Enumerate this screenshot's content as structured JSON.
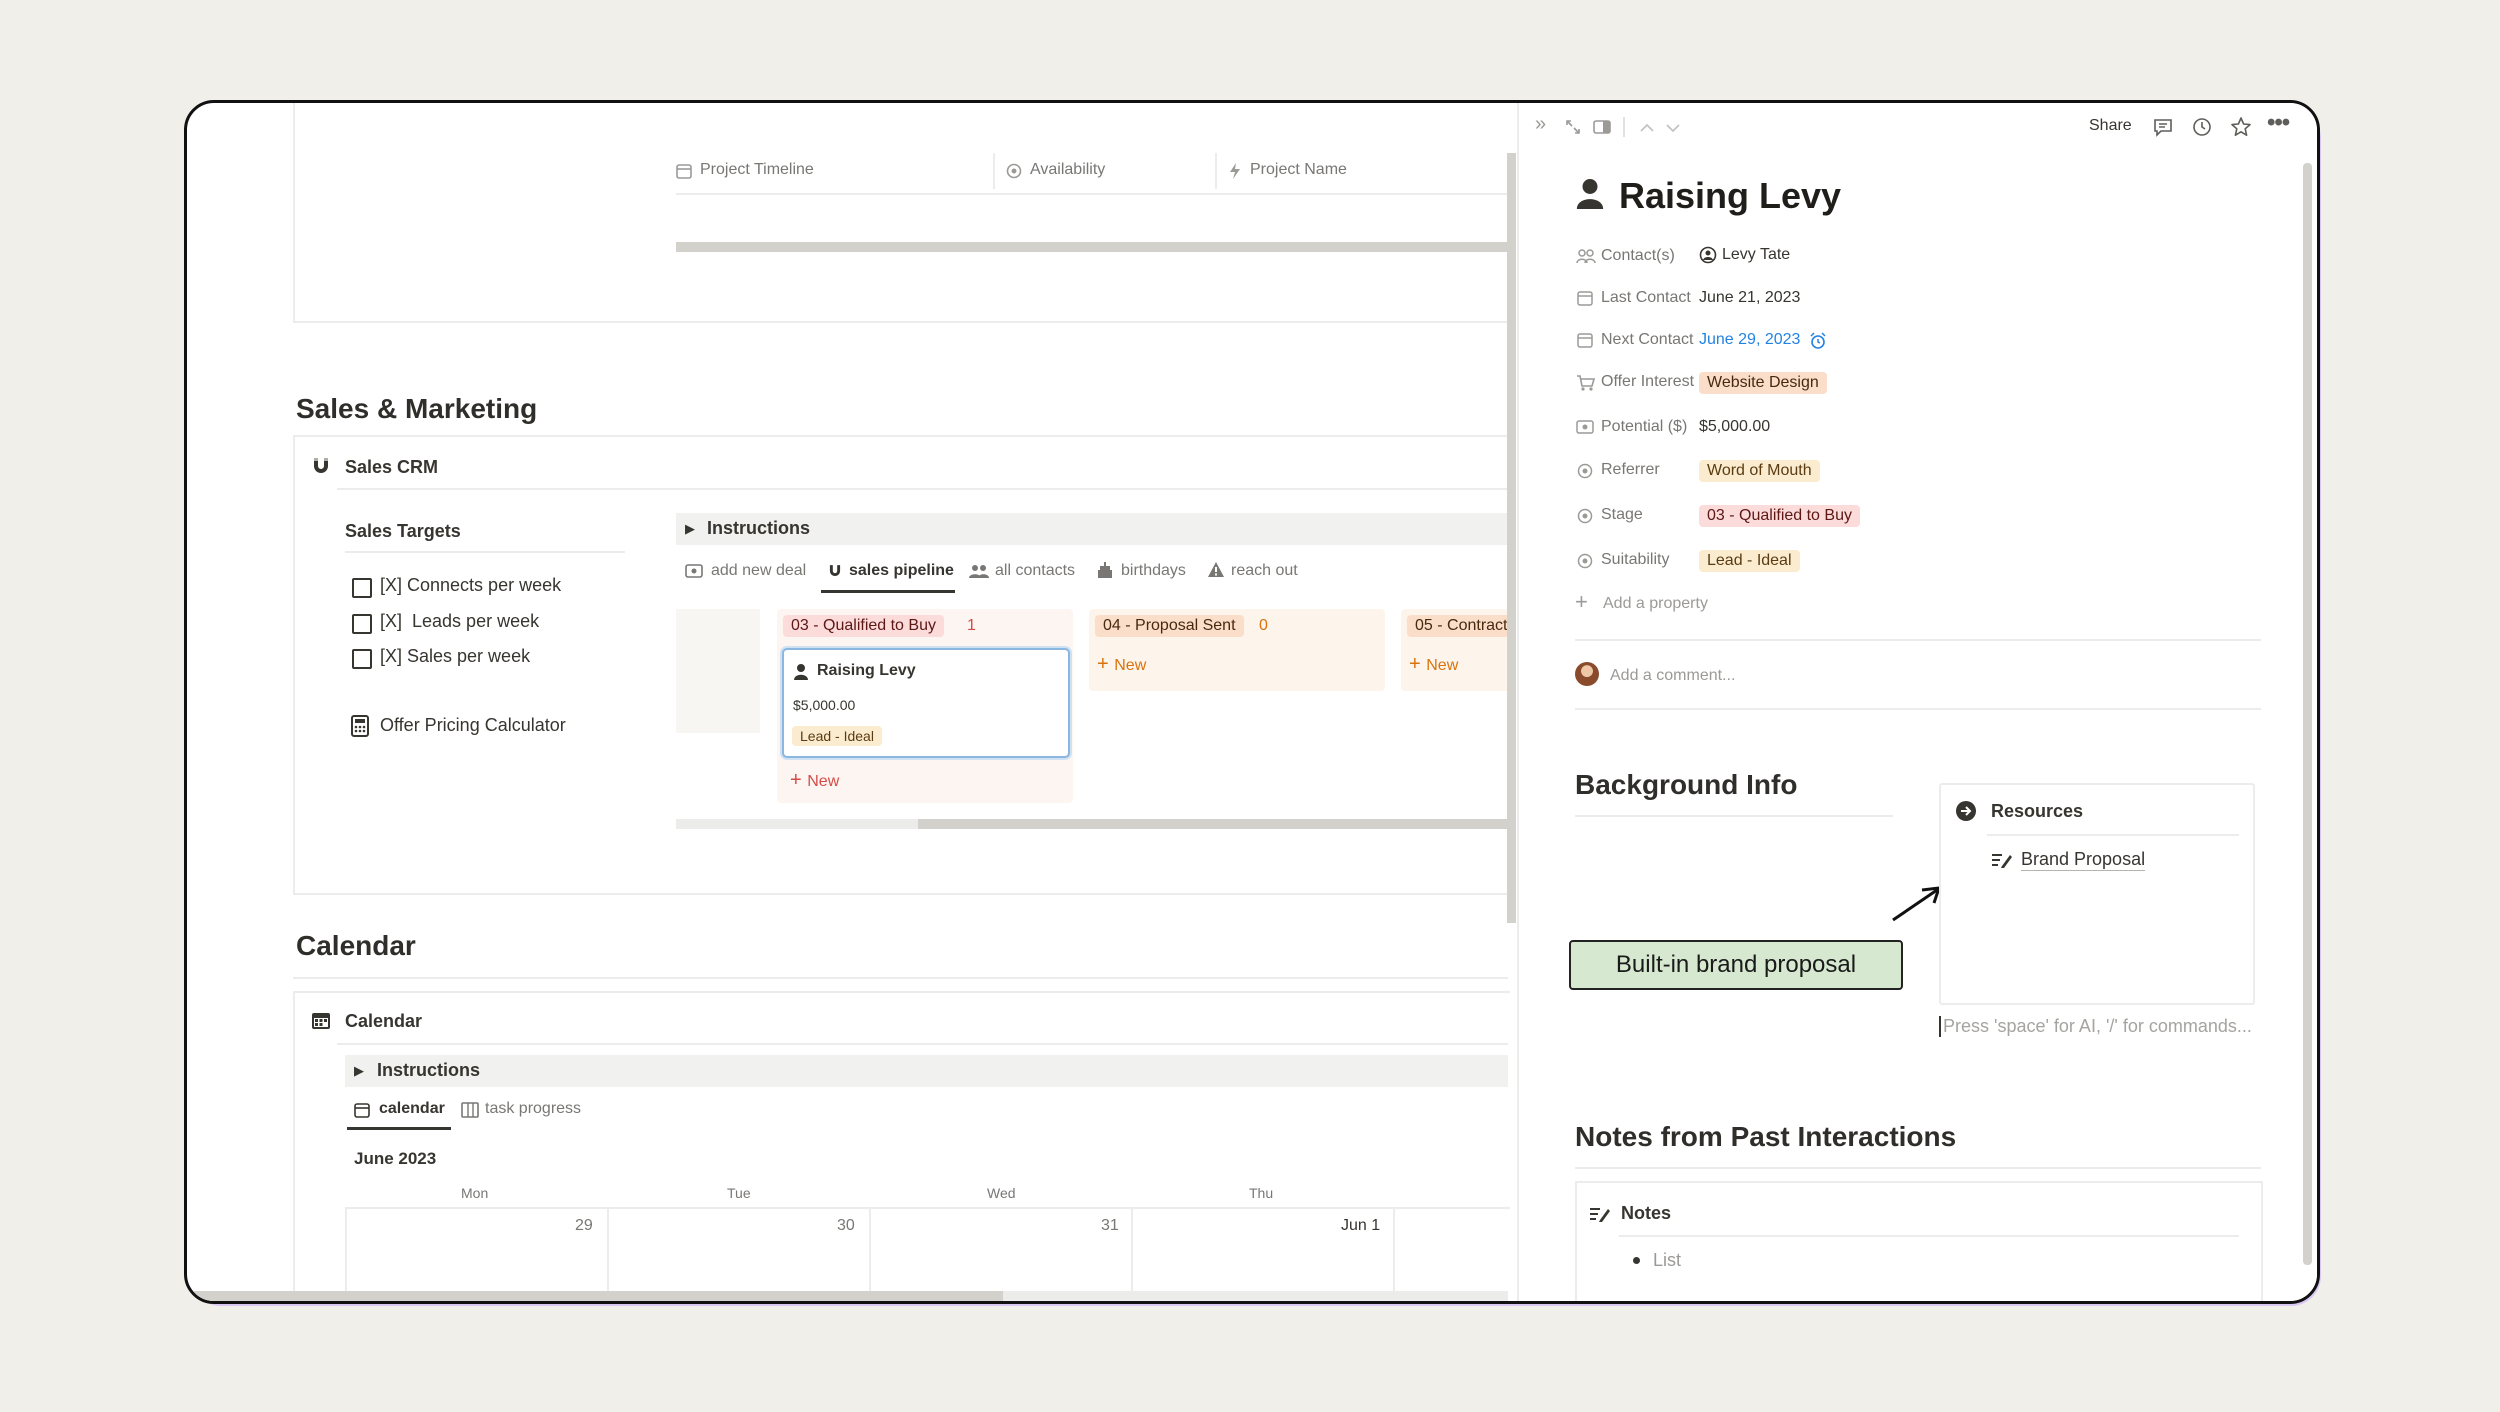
{
  "left": {
    "timeline_headers": [
      "Project Timeline",
      "Availability",
      "Project Name"
    ],
    "sales_section_title": "Sales & Marketing",
    "crm_title": "Sales CRM",
    "sales_targets_title": "Sales Targets",
    "targets": [
      "[X] Connects per week",
      "[X]  Leads per week",
      "[X] Sales per week"
    ],
    "offer_calc": "Offer Pricing Calculator",
    "instructions": "Instructions",
    "tabs": [
      "add new deal",
      "sales pipeline",
      "all contacts",
      "birthdays",
      "reach out"
    ],
    "board": {
      "col1": {
        "name": "03 - Qualified to Buy",
        "count": "1"
      },
      "col2": {
        "name": "04 - Proposal Sent",
        "count": "0"
      },
      "col3": {
        "name": "05 - Contract"
      },
      "card": {
        "title": "Raising Levy",
        "amount": "$5,000.00",
        "tag": "Lead - Ideal"
      },
      "new_label": "New"
    },
    "calendar_section_title": "Calendar",
    "calendar_db_title": "Calendar",
    "calendar_instructions": "Instructions",
    "calendar_tabs": [
      "calendar",
      "task progress"
    ],
    "month": "June 2023",
    "weekdays": [
      "Mon",
      "Tue",
      "Wed",
      "Thu"
    ],
    "days": [
      "29",
      "30",
      "31",
      "Jun 1"
    ]
  },
  "panel": {
    "share": "Share",
    "title": "Raising Levy",
    "properties": {
      "contacts": {
        "label": "Contact(s)",
        "value": "Levy Tate"
      },
      "last_contact": {
        "label": "Last Contact",
        "value": "June 21, 2023"
      },
      "next_contact": {
        "label": "Next Contact",
        "value": "June 29, 2023"
      },
      "offer_interest": {
        "label": "Offer Interest",
        "value": "Website Design"
      },
      "potential": {
        "label": "Potential ($)",
        "value": "$5,000.00"
      },
      "referrer": {
        "label": "Referrer",
        "value": "Word of Mouth"
      },
      "stage": {
        "label": "Stage",
        "value": "03 - Qualified to Buy"
      },
      "suitability": {
        "label": "Suitability",
        "value": "Lead - Ideal"
      }
    },
    "add_property": "Add a property",
    "comment_placeholder": "Add a comment...",
    "background_title": "Background Info",
    "callout": "Built-in brand proposal",
    "resources_title": "Resources",
    "brand_proposal": "Brand Proposal",
    "editor_placeholder": "Press 'space' for AI, '/' for commands...",
    "notes_section_title": "Notes from Past Interactions",
    "notes_title": "Notes",
    "notes_item": "List"
  },
  "colors": {
    "accent_blue": "#2383e2",
    "tag_red": "#fbdcdb",
    "tag_orange": "#fadec9",
    "tag_yellow": "#fbeccf",
    "callout_green": "#d7e8d0",
    "frame_glow": "#d8c8f3"
  }
}
